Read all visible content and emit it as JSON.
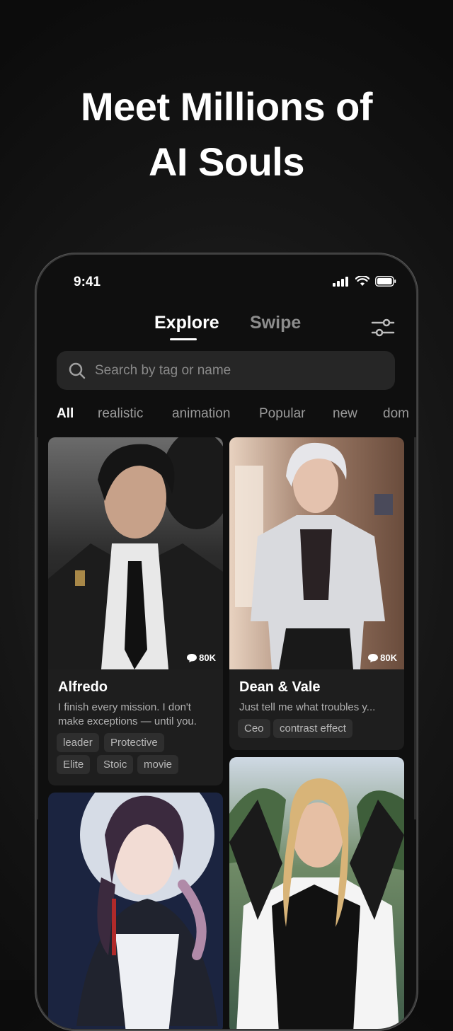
{
  "headline": {
    "line1": "Meet Millions of",
    "line2": "AI Souls"
  },
  "status_bar": {
    "time": "9:41"
  },
  "tabs": {
    "explore": "Explore",
    "swipe": "Swipe"
  },
  "search": {
    "placeholder": "Search by tag or name"
  },
  "categories": [
    "All",
    "realistic",
    "animation",
    "Popular",
    "new",
    "dom"
  ],
  "cards": [
    {
      "name": "Alfredo",
      "description": "I finish every mission. I don't make exceptions — until you.",
      "message_count": "80K",
      "tags": [
        "leader",
        "Protective",
        "Elite",
        "Stoic",
        "movie"
      ]
    },
    {
      "name": "Dean & Vale",
      "description": "Just tell me what troubles y...",
      "message_count": "80K",
      "tags": [
        "Ceo",
        "contrast effect"
      ]
    }
  ],
  "colors": {
    "background": "#0f0f0f",
    "card": "#1e1e1e",
    "tag": "#2e2e2e",
    "muted_text": "#8a8a8a"
  }
}
